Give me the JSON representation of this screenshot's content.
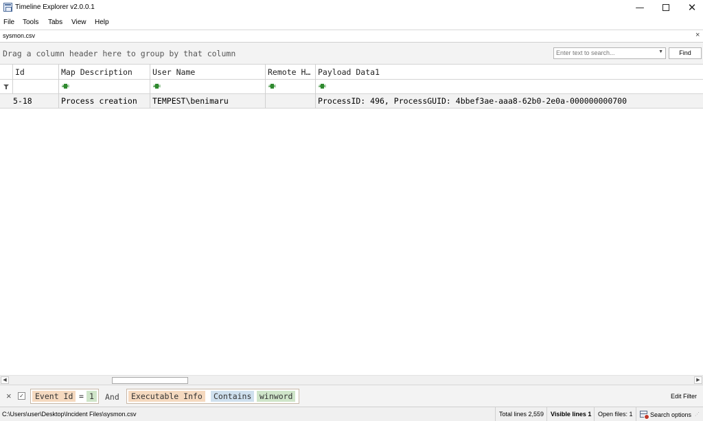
{
  "window": {
    "title": "Timeline Explorer v2.0.0.1",
    "minimize_glyph": "—",
    "close_glyph": "✕"
  },
  "menu": [
    "File",
    "Tools",
    "Tabs",
    "View",
    "Help"
  ],
  "tab": {
    "label": "sysmon.csv",
    "close_glyph": "×"
  },
  "group_panel": {
    "hint": "Drag a column header here to group by that column",
    "search_placeholder": "Enter text to search...",
    "find_label": "Find"
  },
  "grid": {
    "columns": [
      "Id",
      "Map Description",
      "User Name",
      "Remote H…",
      "Payload Data1"
    ],
    "rows": [
      {
        "id": "5-18",
        "map_description": "Process creation",
        "user_name": "TEMPEST\\benimaru",
        "remote_host": "",
        "payload_data1": "ProcessID: 496, ProcessGUID: 4bbef3ae-aaa8-62b0-2e0a-000000000700"
      }
    ]
  },
  "filter_bar": {
    "clear_glyph": "×",
    "checked_glyph": "✓",
    "condition1": {
      "field": "Event Id",
      "operator": "=",
      "value": "1"
    },
    "joiner": "And",
    "condition2": {
      "field": "Executable Info",
      "operator": "Contains",
      "value": "winword"
    },
    "edit_label": "Edit Filter"
  },
  "status_bar": {
    "path": "C:\\Users\\user\\Desktop\\Incident Files\\sysmon.csv",
    "total_lines": "Total lines 2,559",
    "visible_lines": "Visible lines 1",
    "open_files": "Open files: 1",
    "search_options": "Search options"
  },
  "icons": {
    "app": "timeline-app-icon",
    "filter": "funnel-icon",
    "text_filter": "abc-text-filter-icon",
    "search_options": "search-options-icon"
  }
}
